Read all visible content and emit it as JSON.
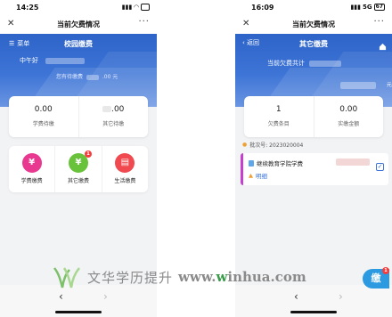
{
  "left": {
    "status": {
      "time": "14:25",
      "network": "",
      "battery": ""
    },
    "nav": {
      "title": "当前欠费情况"
    },
    "banner": {
      "menu_label": "菜单",
      "page_title": "校园缴费",
      "greeting": "中午好",
      "pending_label": "您有待缴费",
      "pending_amount": ".00 元"
    },
    "stats": [
      {
        "value": "0.00",
        "label": "学费待缴"
      },
      {
        "value": ".00",
        "label": "其它待缴"
      }
    ],
    "grid": [
      {
        "icon": "yuan-icon",
        "glyph": "¥",
        "color": "#e8388f",
        "label": "学费缴费",
        "badge": ""
      },
      {
        "icon": "yuan-icon",
        "glyph": "¥",
        "color": "#68c23a",
        "label": "其它缴费",
        "badge": "1"
      },
      {
        "icon": "wallet-icon",
        "glyph": "▤",
        "color": "#f0494f",
        "label": "生活缴费",
        "badge": ""
      }
    ]
  },
  "right": {
    "status": {
      "time": "16:09",
      "network": "5G",
      "battery": "67"
    },
    "nav": {
      "title": "当前欠费情况"
    },
    "banner": {
      "back_label": "返回",
      "page_title": "其它缴费",
      "total_label": "当前欠费共计",
      "yuan": "元"
    },
    "stats": [
      {
        "value": "1",
        "label": "欠费条目"
      },
      {
        "value": "0.00",
        "label": "实缴金额"
      }
    ],
    "batch": "批次号: 2023020004",
    "item": {
      "title": "继续教育学院学费",
      "detail_link": "明细",
      "check": "✓"
    },
    "float_badge": "1"
  },
  "watermark": {
    "text": "文华学历提升",
    "url_prefix": "www.",
    "url_w": "w",
    "url_rest": "inhua.com"
  },
  "colors": {
    "primary": "#3d74d6",
    "accent_pink": "#c73fd0",
    "badge_red": "#f53d3d"
  }
}
